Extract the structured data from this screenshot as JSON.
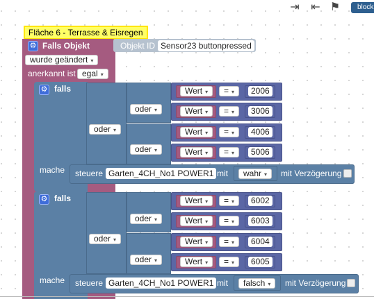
{
  "toolbar": {
    "export_icon": "export-icon",
    "import_icon": "import-icon",
    "finish_icon": "checkered-flag-icon",
    "blockly_label": "blockly"
  },
  "comment": "Fläche 6 - Terrasse & Eisregen",
  "trigger": {
    "title": "Falls Objekt",
    "object_id_label": "Objekt ID",
    "object_id_value": "Sensor23 buttonpressed",
    "changed": "wurde geändert",
    "ack_label": "anerkannt ist",
    "ack_value": "egal"
  },
  "if1": {
    "falls": "falls",
    "or_outer": "oder",
    "or_inner_1": "oder",
    "or_inner_2": "oder",
    "comparisons": [
      {
        "var": "Wert",
        "op": "=",
        "value": "2006"
      },
      {
        "var": "Wert",
        "op": "=",
        "value": "3006"
      },
      {
        "var": "Wert",
        "op": "=",
        "value": "4006"
      },
      {
        "var": "Wert",
        "op": "=",
        "value": "5006"
      }
    ],
    "mache": "mache",
    "action": {
      "steuere": "steuere",
      "target": "Garten_4CH_No1 POWER1",
      "mit": "mit",
      "value": "wahr",
      "delay_label": "mit Verzögerung"
    }
  },
  "if2": {
    "falls": "falls",
    "or_outer": "oder",
    "or_inner_1": "oder",
    "or_inner_2": "oder",
    "comparisons": [
      {
        "var": "Wert",
        "op": "=",
        "value": "6002"
      },
      {
        "var": "Wert",
        "op": "=",
        "value": "6003"
      },
      {
        "var": "Wert",
        "op": "=",
        "value": "6004"
      },
      {
        "var": "Wert",
        "op": "=",
        "value": "6005"
      }
    ],
    "mache": "mache",
    "action": {
      "steuere": "steuere",
      "target": "Garten_4CH_No1 POWER1",
      "mit": "mit",
      "value": "falsch",
      "delay_label": "mit Verzögerung"
    }
  },
  "colors": {
    "trigger_block": "#a55b80",
    "logic_block": "#5b80a5",
    "var_block": "#a55b80",
    "math_block": "#5b67a5",
    "comment_bg": "#ffff66"
  }
}
